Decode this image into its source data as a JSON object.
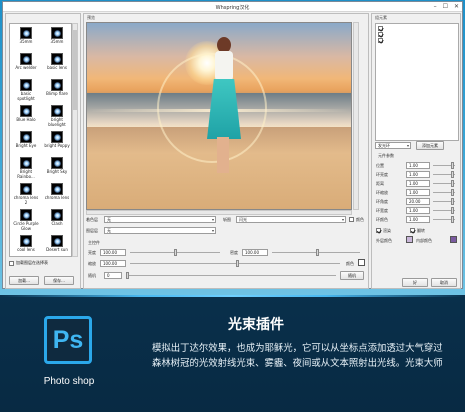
{
  "window": {
    "title": "Whspring汉化"
  },
  "left_panel": {
    "group_label": "",
    "presets": [
      {
        "label": "35mm"
      },
      {
        "label": "35mm"
      },
      {
        "label": "Arc welder"
      },
      {
        "label": "basic lens"
      },
      {
        "label": "basic spotlight"
      },
      {
        "label": "Blimp flare"
      },
      {
        "label": "Blue Halo"
      },
      {
        "label": "bright bluelight"
      },
      {
        "label": "Bright Eye"
      },
      {
        "label": "bright Poppy"
      },
      {
        "label": "Bright Rainbo..."
      },
      {
        "label": "Bright Sky"
      },
      {
        "label": "chroma lens 2"
      },
      {
        "label": "chroma lens"
      },
      {
        "label": "Circle Purple Glow"
      },
      {
        "label": "Clash"
      },
      {
        "label": "cool lens"
      },
      {
        "label": "Desert sun"
      }
    ],
    "checkbox_label": "加载图层在选择表",
    "load_button": "加载...",
    "save_button": "保存..."
  },
  "preview": {
    "group_label": "预览",
    "style_label": "着色层",
    "style_value": "无",
    "mode_label": "斩图",
    "mode_value": "闪光",
    "checkbox_label": "颜色",
    "layer_label": "图层层",
    "layer_value": "无",
    "main_param_label": "主控件",
    "brightness_label": "亮度",
    "brightness_value": "100.00",
    "scale_label": "缩放",
    "scale_value": "100.00",
    "density_label": "密度",
    "density_value": "100.00",
    "color_label": "颜色",
    "random_label": "随机",
    "random_value": "0",
    "random_button": "随机"
  },
  "right_panel": {
    "group_label": "组元素",
    "layers": [
      true,
      true,
      true
    ],
    "element_type": "发光环",
    "add_button": "添加元素",
    "params_title": "元件参数",
    "params": [
      {
        "label": "位置",
        "value": "1.00"
      },
      {
        "label": "环亮度",
        "value": "1.00"
      },
      {
        "label": "距离",
        "value": "1.00"
      },
      {
        "label": "环缩放",
        "value": "1.00"
      },
      {
        "label": "环角度",
        "value": "20.00"
      },
      {
        "label": "环宽度",
        "value": "1.00"
      },
      {
        "label": "环颜色",
        "value": "1.00"
      }
    ],
    "check_a": "渲染",
    "check_b": "翻转",
    "inner_color_label": "外层颜色",
    "outer_color_label": "内部颜色",
    "ok_button": "好",
    "cancel_button": "取消"
  },
  "colors": {
    "accent": "#2ba8ea",
    "banner_bg": "#0a3350",
    "inner_swatch": "#c9b6d9",
    "outer_swatch": "#7a5aa0"
  },
  "banner": {
    "logo_text": "Ps",
    "logo_caption": "Photo shop",
    "title": "光束插件",
    "description": "模拟出丁达尔效果，也成为耶稣光，它可以从坐标点添加透过大气穿过森林树冠的光效射线光束、雾霾、夜间或从文本照射出光线。光束大师"
  }
}
